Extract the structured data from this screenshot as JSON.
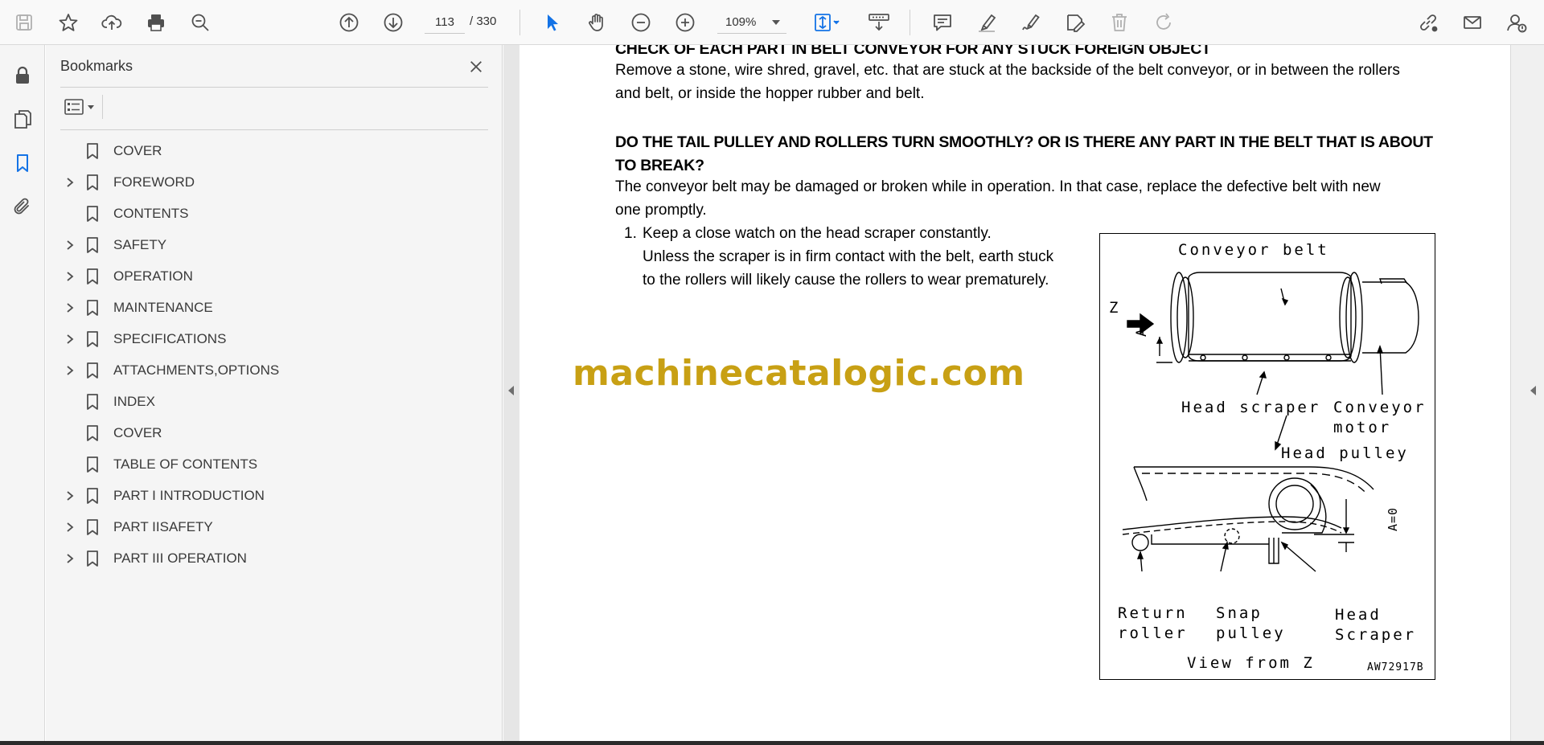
{
  "toolbar": {
    "page_current": "113",
    "page_total": "/ 330",
    "zoom": "109%",
    "icons": [
      "save-icon",
      "star-icon",
      "upload-icon",
      "print-icon",
      "find-icon",
      "page-up-icon",
      "page-down-icon",
      "select-arrow-icon",
      "hand-icon",
      "zoom-out-icon",
      "zoom-in-icon",
      "fit-page-icon",
      "scroll-mode-icon",
      "comment-icon",
      "highlight-icon",
      "sign-icon",
      "fill-sign-icon",
      "delete-icon",
      "redo-icon",
      "share-link-icon",
      "email-icon",
      "account-icon"
    ]
  },
  "rail": {
    "icons": [
      "lock-icon",
      "pages-icon",
      "bookmarks-icon",
      "attachment-icon"
    ]
  },
  "bookmarks": {
    "title": "Bookmarks",
    "items": [
      {
        "label": "COVER",
        "expandable": false
      },
      {
        "label": "FOREWORD",
        "expandable": true
      },
      {
        "label": "CONTENTS",
        "expandable": false
      },
      {
        "label": "SAFETY",
        "expandable": true
      },
      {
        "label": "OPERATION",
        "expandable": true
      },
      {
        "label": "MAINTENANCE",
        "expandable": true
      },
      {
        "label": "SPECIFICATIONS",
        "expandable": true
      },
      {
        "label": "ATTACHMENTS,OPTIONS",
        "expandable": true
      },
      {
        "label": "INDEX",
        "expandable": false
      },
      {
        "label": "COVER",
        "expandable": false
      },
      {
        "label": "TABLE OF CONTENTS",
        "expandable": false
      },
      {
        "label": "PART I INTRODUCTION",
        "expandable": true
      },
      {
        "label": "PART IISAFETY",
        "expandable": true
      },
      {
        "label": "PART III OPERATION",
        "expandable": true
      }
    ]
  },
  "document": {
    "heading1": "CHECK OF EACH PART IN BELT CONVEYOR FOR ANY STUCK FOREIGN OBJECT",
    "para1_line1": "Remove a stone, wire shred, gravel, etc. that are stuck at the backside of the belt conveyor, or in between the rollers",
    "para1_line2": "and belt, or inside the hopper rubber and belt.",
    "heading2_line1": "DO THE TAIL PULLEY AND ROLLERS TURN SMOOTHLY? OR IS THERE ANY PART IN THE BELT THAT IS ABOUT",
    "heading2_line2": "TO BREAK?",
    "para2_line1": "The conveyor belt may be damaged or broken while in operation. In that case, replace the defective belt with new",
    "para2_line2": "one promptly.",
    "list_number": "1.",
    "list_line1": "Keep a close watch on the head scraper constantly.",
    "list_line2": "Unless the scraper is in firm contact with the belt, earth stuck",
    "list_line3": "to the rollers will likely cause the rollers to wear prematurely.",
    "watermark": "machinecatalogic.com",
    "figure": {
      "conveyor_belt": "Conveyor belt",
      "z": "Z",
      "a": "A",
      "head_scraper": "Head scraper",
      "conveyor_motor_1": "Conveyor",
      "conveyor_motor_2": "motor",
      "head_pulley": "Head pulley",
      "a_eq": "A=0",
      "return_roller_1": "Return",
      "return_roller_2": "roller",
      "snap_pulley_1": "Snap",
      "snap_pulley_2": "pulley",
      "head_scraper2_1": "Head",
      "head_scraper2_2": "Scraper",
      "view_from_z": "View from Z",
      "code": "AW72917B"
    }
  },
  "colors": {
    "accent_blue": "#1473e6",
    "watermark": "#c8a014",
    "icon_gray": "#505050",
    "disabled_gray": "#b0b0b0"
  }
}
